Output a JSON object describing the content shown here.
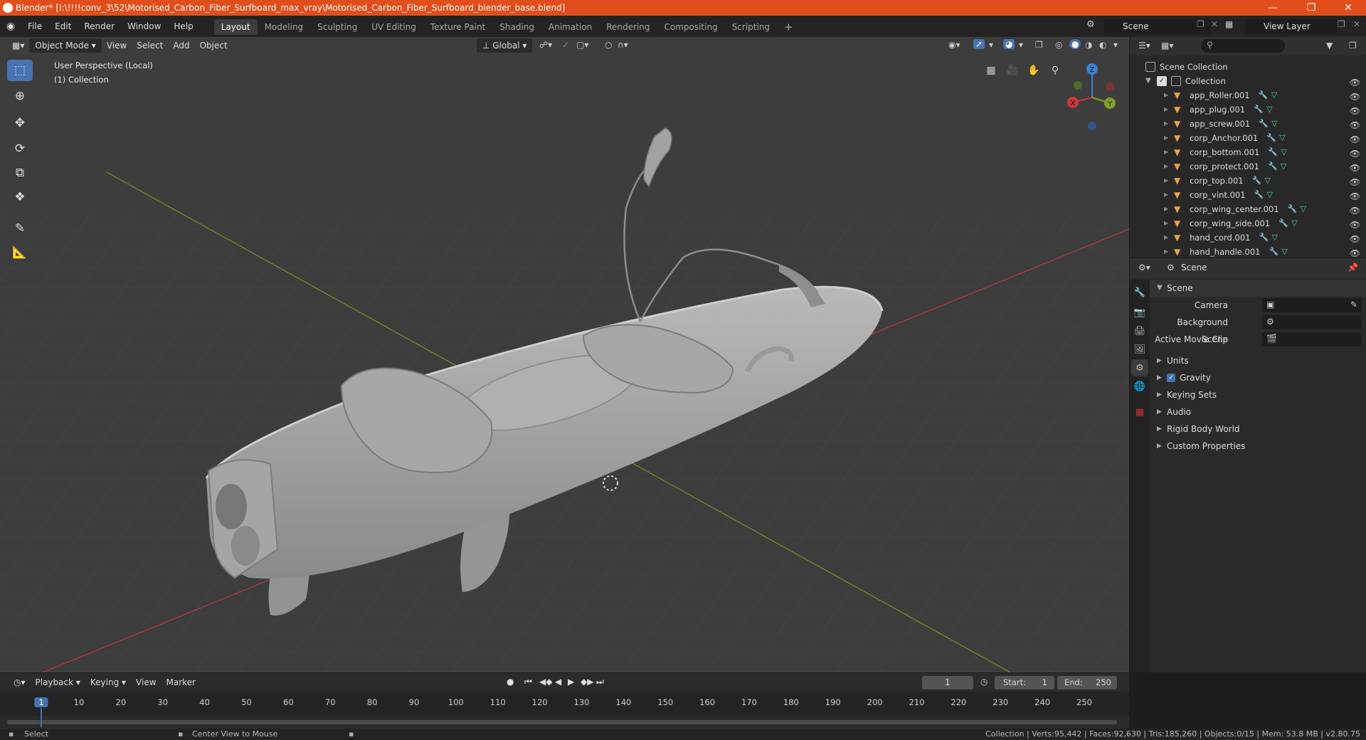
{
  "window": {
    "title": "Blender* [I:\\!!!!conv_3\\52\\Motorised_Carbon_Fiber_Surfboard_max_vray\\Motorised_Carbon_Fiber_Surfboard_blender_base.blend]"
  },
  "menus": [
    "File",
    "Edit",
    "Render",
    "Window",
    "Help"
  ],
  "workspaces": [
    "Layout",
    "Modeling",
    "Sculpting",
    "UV Editing",
    "Texture Paint",
    "Shading",
    "Animation",
    "Rendering",
    "Compositing",
    "Scripting"
  ],
  "scene_field": "Scene",
  "view_layer_field": "View Layer",
  "viewport": {
    "mode": "Object Mode",
    "menus": [
      "View",
      "Select",
      "Add",
      "Object"
    ],
    "transform_orientation": "Global",
    "overlay_line1": "User Perspective (Local)",
    "overlay_line2": "(1) Collection",
    "gizmo": {
      "x": "X",
      "y": "Y",
      "z": "Z"
    }
  },
  "outliner": {
    "root": "Scene Collection",
    "collection": "Collection",
    "objects": [
      "app_Roller.001",
      "app_plug.001",
      "app_screw.001",
      "corp_Anchor.001",
      "corp_bottom.001",
      "corp_protect.001",
      "corp_top.001",
      "corp_vint.001",
      "corp_wing_center.001",
      "corp_wing_side.001",
      "hand_cord.001",
      "hand_handle.001"
    ]
  },
  "properties": {
    "context": "Scene",
    "panel": "Scene",
    "camera_label": "Camera",
    "background_scene_label": "Background Scene",
    "active_clip_label": "Active Movie Clip",
    "sections": [
      "Units",
      "Gravity",
      "Keying Sets",
      "Audio",
      "Rigid Body World",
      "Custom Properties"
    ],
    "gravity_checked": true
  },
  "timeline": {
    "menus": [
      "Playback",
      "Keying",
      "View",
      "Marker"
    ],
    "current_frame": "1",
    "start_label": "Start:",
    "start": "1",
    "end_label": "End:",
    "end": "250",
    "ruler": [
      "1",
      "10",
      "20",
      "30",
      "40",
      "50",
      "60",
      "70",
      "80",
      "90",
      "100",
      "110",
      "120",
      "130",
      "140",
      "150",
      "160",
      "170",
      "180",
      "190",
      "200",
      "210",
      "220",
      "230",
      "240",
      "250"
    ]
  },
  "status": {
    "left1": "Select",
    "left2": "Center View to Mouse",
    "right": "Collection | Verts:95,442 | Faces:92,630 | Tris:185,260 | Objects:0/15 | Mem: 53.8 MB | v2.80.75"
  },
  "colors": {
    "title_bar": "#e24e1b",
    "accent": "#4772b3",
    "viewport_bg": "#3d3d3d",
    "axis_x": "#c8383f",
    "axis_y": "#7ea31e",
    "axis_z": "#3b83d8"
  }
}
